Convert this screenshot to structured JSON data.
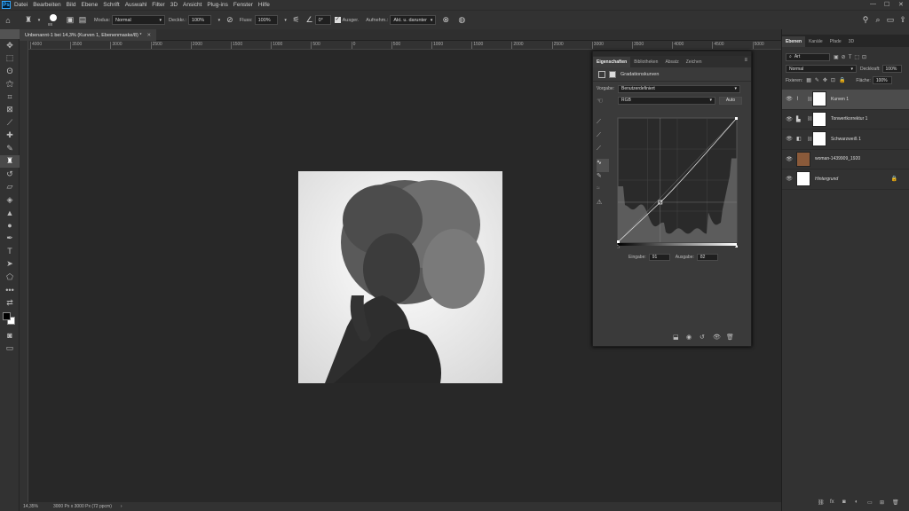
{
  "menu": {
    "logo": "Ps",
    "items": [
      "Datei",
      "Bearbeiten",
      "Bild",
      "Ebene",
      "Schrift",
      "Auswahl",
      "Filter",
      "3D",
      "Ansicht",
      "Plug-ins",
      "Fenster",
      "Hilfe"
    ]
  },
  "options": {
    "brush_size": "88",
    "mode_label": "Modus:",
    "mode_value": "Normal",
    "opacity_label": "Deckkr.:",
    "opacity_value": "100%",
    "flow_label": "Fluss:",
    "flow_value": "100%",
    "angle_value": "0°",
    "align_label": "Ausger.",
    "sample_label": "Aufnehm.:",
    "sample_value": "Akt. u. darunter"
  },
  "document": {
    "tab_title": "Unbenannt-1 bei 14,3% (Kurven 1, Ebenenmaske/8) *"
  },
  "ruler_ticks": [
    "4000",
    "3500",
    "3000",
    "2500",
    "2000",
    "1500",
    "1000",
    "500",
    "0",
    "500",
    "1000",
    "1500",
    "2000",
    "2500",
    "3000",
    "3500",
    "4000",
    "4500",
    "5000"
  ],
  "status": {
    "zoom": "14,35%",
    "doc_size": "3000 Px x 3000 Px (72 ppcm)",
    "arrow": "›"
  },
  "properties": {
    "tabs": [
      "Eigenschaften",
      "Bibliotheken",
      "Absatz",
      "Zeichen"
    ],
    "adjustment_title": "Gradationskurven",
    "preset_label": "Vorgabe:",
    "preset_value": "Benutzerdefiniert",
    "channel_value": "RGB",
    "auto_label": "Auto",
    "input_label": "Eingabe:",
    "input_value": "91",
    "output_label": "Ausgabe:",
    "output_value": "82"
  },
  "layers_panel": {
    "tabs": [
      "Ebenen",
      "Kanäle",
      "Pfade",
      "3D"
    ],
    "filter_value": "Art",
    "blend_mode": "Normal",
    "opacity_label": "Deckkraft:",
    "opacity_value": "100%",
    "lock_label": "Fixieren:",
    "fill_label": "Fläche:",
    "fill_value": "100%",
    "layers": [
      {
        "name": "Kurven 1",
        "type": "adjustment"
      },
      {
        "name": "Tonwertkorrektur 1",
        "type": "adjustment"
      },
      {
        "name": "Schwarzweiß 1",
        "type": "adjustment"
      },
      {
        "name": "woman-1439909_1920",
        "type": "photo"
      },
      {
        "name": "Hintergrund",
        "type": "background"
      }
    ]
  },
  "curve": {
    "input": 91,
    "output": 82
  }
}
